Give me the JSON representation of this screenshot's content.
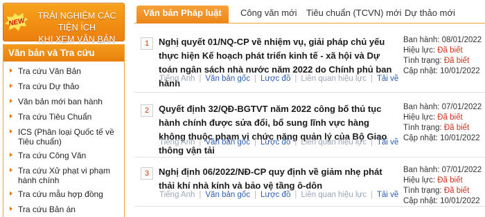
{
  "promo": {
    "badge": "NEW",
    "line1": "TRẢI NGHIỆM CÁC TIỆN ÍCH",
    "line2": "KHI XEM VĂN BẢN"
  },
  "sidebar": {
    "title": "Văn bản và Tra cứu",
    "items": [
      {
        "label": "Tra cứu Văn Bản"
      },
      {
        "label": "Tra cứu Dự thảo"
      },
      {
        "label": "Văn bản mới ban hành"
      },
      {
        "label": "Tra cứu Tiêu Chuẩn"
      },
      {
        "label": "ICS (Phân loại Quốc tế về Tiêu chuẩn)"
      },
      {
        "label": "Tra cứu Công Văn"
      },
      {
        "label": "Tra cứu Xử phạt vi phạm hành chính"
      },
      {
        "label": "Tra cứu mẫu hợp đồng"
      },
      {
        "label": "Tra cứu Bản án"
      }
    ]
  },
  "tabs": [
    {
      "label": "Văn bản Pháp luật mới"
    },
    {
      "label": "Công văn mới"
    },
    {
      "label": "Tiêu chuẩn (TCVN) mới"
    },
    {
      "label": "Dự thảo mới"
    }
  ],
  "documents": [
    {
      "num": "1",
      "title": "Nghị quyết 01/NQ-CP về nhiệm vụ, giải pháp chủ yếu thực hiện Kế hoạch phát triển kinh tế - xã hội và Dự toán ngân sách nhà nước năm 2022 do Chính phủ ban hành",
      "issued_label": "Ban hành:",
      "issued": "08/01/2022",
      "effect_label": "Hiệu lực:",
      "effect": "Đã biết",
      "status_label": "Tình trạng:",
      "status": "Đã biết",
      "updated_label": "Cập nhật:",
      "updated": "10/01/2022",
      "links": {
        "english": "Tiếng Anh",
        "original": "Văn bản gốc",
        "diagram": "Lược đồ",
        "related": "Liên quan hiệu lực",
        "download": "Tải về"
      }
    },
    {
      "num": "2",
      "title": "Quyết định 32/QĐ-BGTVT năm 2022 công bố thủ tục hành chính được sửa đổi, bổ sung lĩnh vực hàng không thuộc phạm vi chức năng quản lý của Bộ Giao thông vận tải",
      "issued_label": "Ban hành:",
      "issued": "07/01/2022",
      "effect_label": "Hiệu lực:",
      "effect": "Đã biết",
      "status_label": "Tình trạng:",
      "status": "Đã biết",
      "updated_label": "Cập nhật:",
      "updated": "10/01/2022",
      "links": {
        "english": "Tiếng Anh",
        "original": "Văn bản gốc",
        "diagram": "Lược đồ",
        "related": "Liên quan hiệu lực",
        "download": "Tải về"
      }
    },
    {
      "num": "3",
      "title": "Nghị định 06/2022/NĐ-CP quy định về giảm nhẹ phát thải khí nhà kính và bảo vệ tầng ô-dôn",
      "issued_label": "Ban hành:",
      "issued": "07/01/2022",
      "effect_label": "Hiệu lực:",
      "effect": "Đã biết",
      "status_label": "Tình trạng:",
      "status": "Đã biết",
      "updated_label": "Cập nhật:",
      "updated": "10/01/2022",
      "links": {
        "english": "Tiếng Anh",
        "original": "Văn bản gốc",
        "diagram": "Lược đồ",
        "related": "Liên quan hiệu lực",
        "download": "Tải về"
      }
    }
  ],
  "colors": {
    "accent": "#f39a1c",
    "link": "#2a5db0",
    "status_red": "#d0301a"
  }
}
